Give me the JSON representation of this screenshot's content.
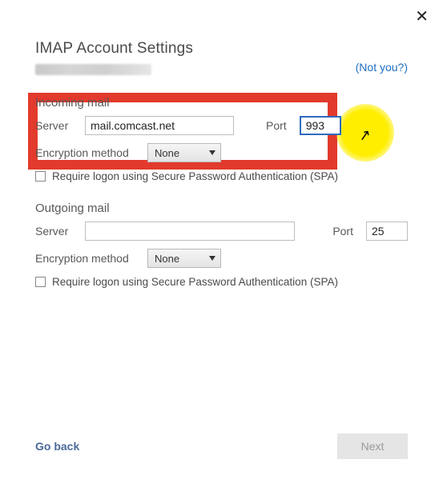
{
  "dialog": {
    "title": "IMAP Account Settings",
    "not_you": "(Not you?)",
    "close_label": "✕"
  },
  "incoming": {
    "heading": "Incoming mail",
    "server_label": "Server",
    "server_value": "mail.comcast.net",
    "port_label": "Port",
    "port_value": "993",
    "encryption_label": "Encryption method",
    "encryption_value": "None",
    "spa_label": "Require logon using Secure Password Authentication (SPA)",
    "spa_checked": false
  },
  "outgoing": {
    "heading": "Outgoing mail",
    "server_label": "Server",
    "server_value": "",
    "port_label": "Port",
    "port_value": "25",
    "encryption_label": "Encryption method",
    "encryption_value": "None",
    "spa_label": "Require logon using Secure Password Authentication (SPA)",
    "spa_checked": false
  },
  "footer": {
    "go_back": "Go back",
    "next": "Next"
  },
  "annotations": {
    "highlight_box": true,
    "cursor_spotlight": true
  }
}
